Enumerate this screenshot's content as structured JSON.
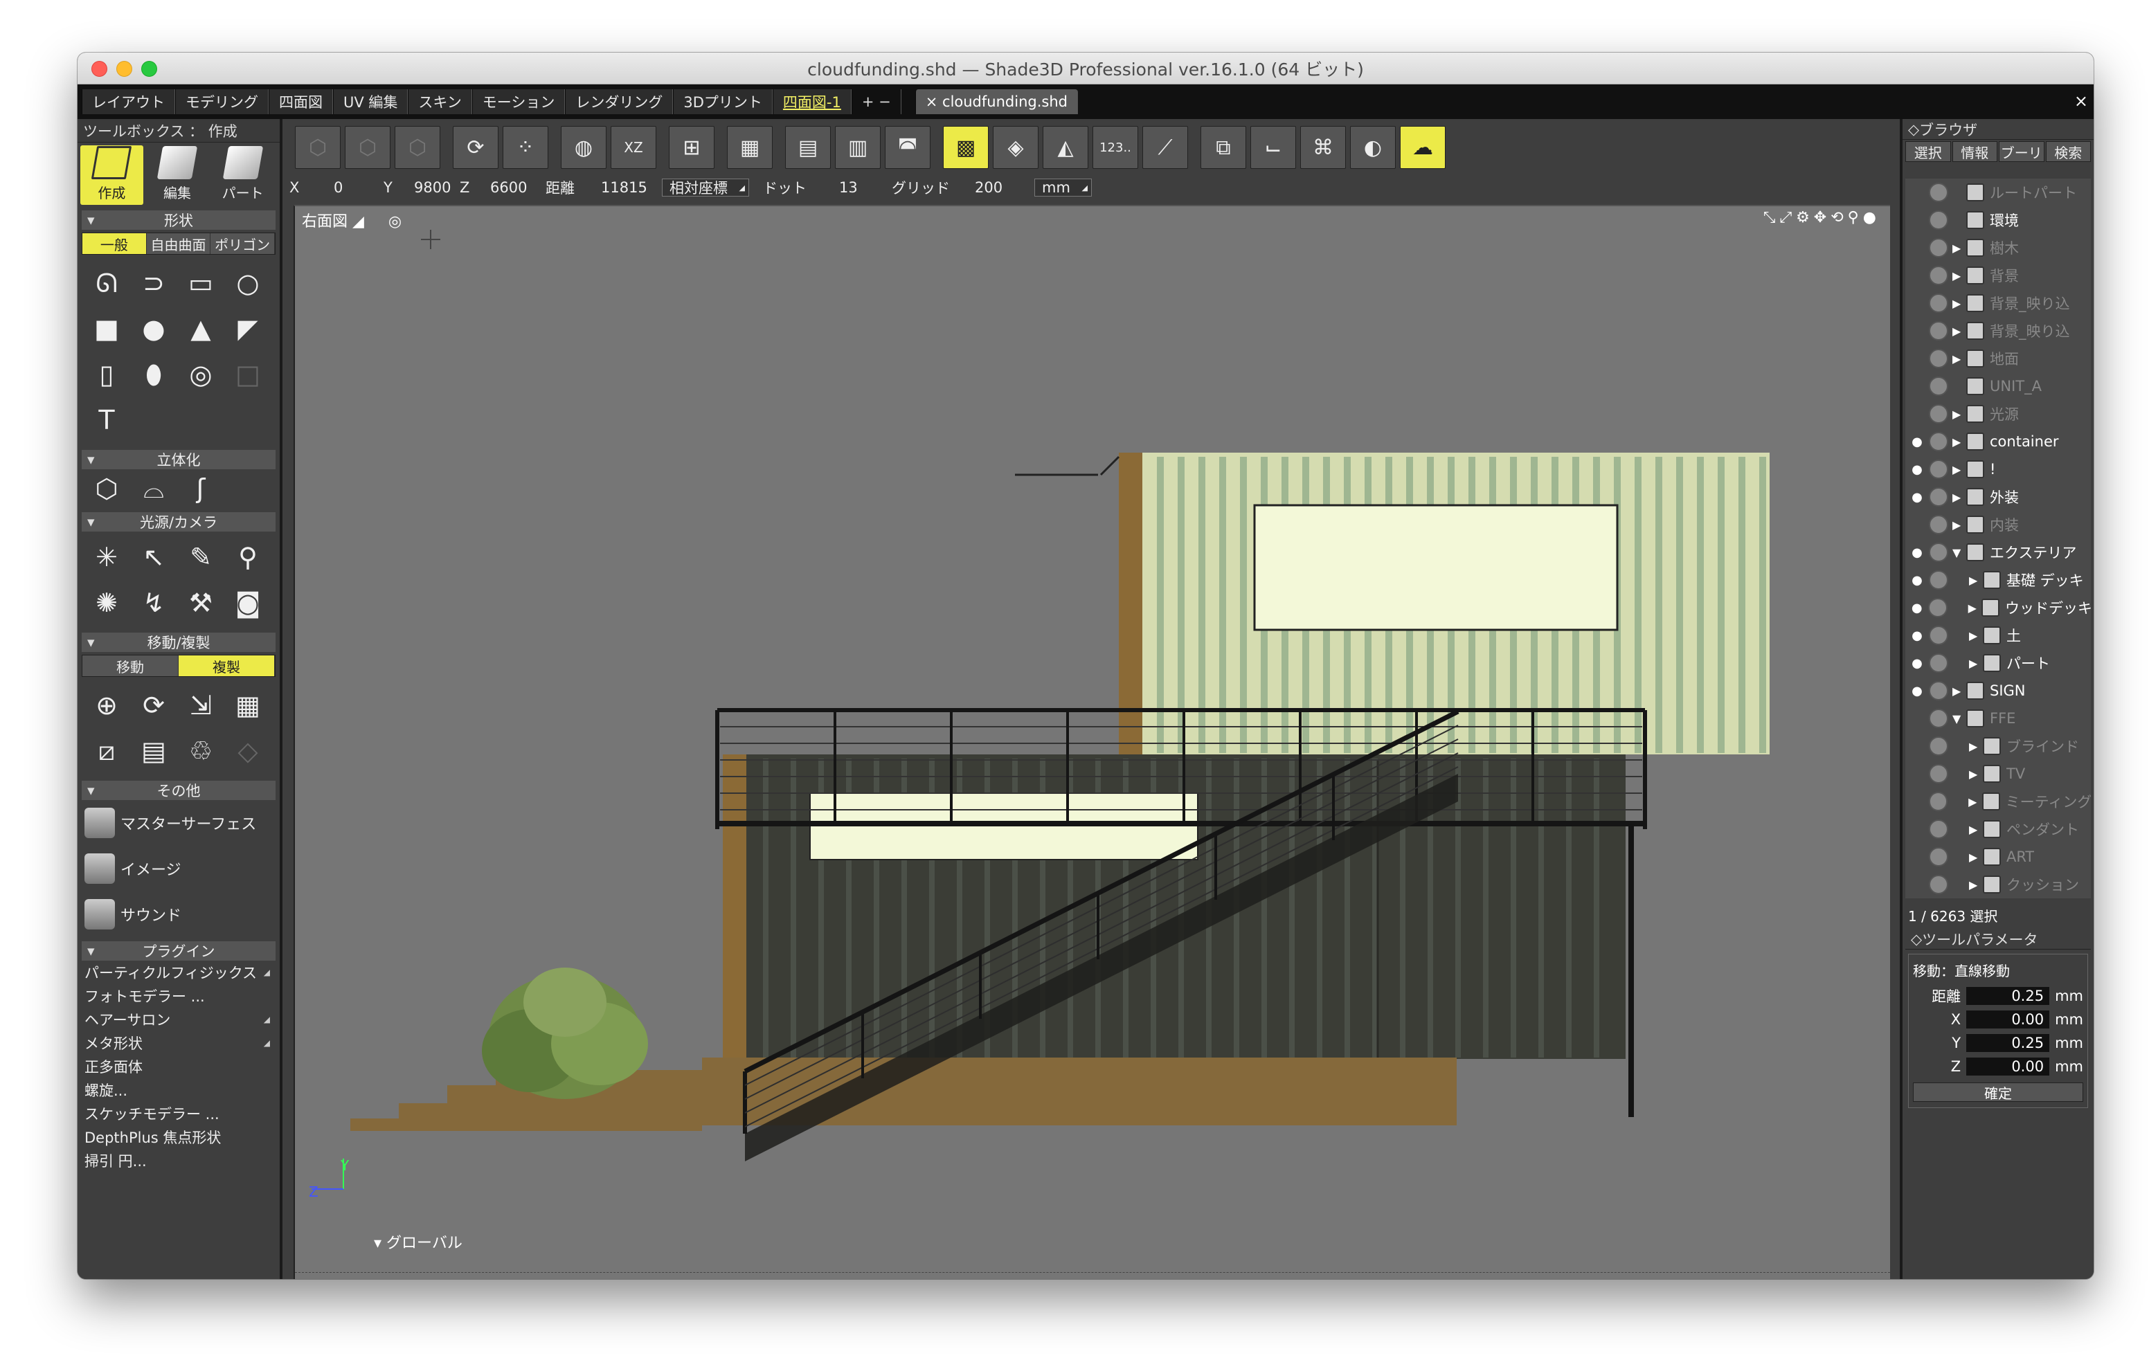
{
  "window": {
    "title": "cloudfunding.shd — Shade3D Professional ver.16.1.0 (64 ビット)"
  },
  "tabs": [
    "レイアウト",
    "モデリング",
    "四面図",
    "UV 編集",
    "スキン",
    "モーション",
    "レンダリング",
    "3Dプリント"
  ],
  "active_tab": "四面図-1",
  "tab_plus": "+ −",
  "doc_tab": "× cloudfunding.shd",
  "toolbox": {
    "title": "ツールボックス ： 作成",
    "modes": [
      "作成",
      "編集",
      "パート"
    ],
    "sections": {
      "shape": "形状",
      "solidify": "立体化",
      "light_camera": "光源/カメラ",
      "move_copy": "移動/複製",
      "other": "その他",
      "plugin": "プラグイン"
    },
    "shape_tabs": [
      "一般",
      "自由曲面",
      "ポリゴン"
    ],
    "move_tabs": [
      "移動",
      "複製"
    ],
    "other_items": [
      "マスターサーフェス",
      "イメージ",
      "サウンド"
    ],
    "plugins": [
      "パーティクルフィジックス",
      "フォトモデラー ...",
      "ヘアーサロン",
      "メタ形状",
      "正多面体",
      "螺旋...",
      "スケッチモデラー ...",
      "DepthPlus 焦点形状",
      "掃引 円..."
    ]
  },
  "coords": {
    "x_label": "X",
    "x": "0",
    "y_label": "Y",
    "y": "9800",
    "z_label": "Z",
    "z": "6600",
    "dist_label": "距離",
    "dist": "11815",
    "mode": "相対座標",
    "dot_label": "ドット",
    "dot": "13",
    "grid_label": "グリッド",
    "grid": "200",
    "unit": "mm"
  },
  "viewport": {
    "view": "右面図",
    "global": "グローバル",
    "axis_y": "Y",
    "axis_z": "Z"
  },
  "toolbar_labels": {
    "xz": "XZ",
    "num": "123.."
  },
  "browser": {
    "title": "ブラウザ",
    "tabs": [
      "選択",
      "情報",
      "ブーリ",
      "検索"
    ],
    "tree": [
      {
        "label": "ルートパート",
        "eye": "",
        "indent": 0,
        "toggle": "",
        "dim": true
      },
      {
        "label": "環境",
        "eye": "",
        "indent": 0,
        "toggle": "",
        "dim": false
      },
      {
        "label": "樹木",
        "eye": "",
        "indent": 0,
        "toggle": "▶",
        "dim": true
      },
      {
        "label": "背景",
        "eye": "",
        "indent": 0,
        "toggle": "▶",
        "dim": true
      },
      {
        "label": "背景_映り込",
        "eye": "",
        "indent": 0,
        "toggle": "▶",
        "dim": true
      },
      {
        "label": "背景_映り込",
        "eye": "",
        "indent": 0,
        "toggle": "▶",
        "dim": true
      },
      {
        "label": "地面",
        "eye": "",
        "indent": 0,
        "toggle": "▶",
        "dim": true
      },
      {
        "label": "UNIT_A",
        "eye": "",
        "indent": 0,
        "toggle": "",
        "dim": true
      },
      {
        "label": "光源",
        "eye": "",
        "indent": 0,
        "toggle": "▶",
        "dim": true
      },
      {
        "label": "container",
        "eye": "●",
        "indent": 0,
        "toggle": "▶",
        "dim": false
      },
      {
        "label": "!",
        "eye": "●",
        "indent": 0,
        "toggle": "▶",
        "dim": false
      },
      {
        "label": "外装",
        "eye": "●",
        "indent": 0,
        "toggle": "▶",
        "dim": false
      },
      {
        "label": "内装",
        "eye": "",
        "indent": 0,
        "toggle": "▶",
        "dim": true
      },
      {
        "label": "エクステリア",
        "eye": "●",
        "indent": 0,
        "toggle": "▼",
        "dim": false
      },
      {
        "label": "基礎 デッキ",
        "eye": "●",
        "indent": 1,
        "toggle": "▶",
        "dim": false
      },
      {
        "label": "ウッドデッキ",
        "eye": "●",
        "indent": 1,
        "toggle": "▶",
        "dim": false
      },
      {
        "label": "土",
        "eye": "●",
        "indent": 1,
        "toggle": "▶",
        "dim": false
      },
      {
        "label": "パート",
        "eye": "●",
        "indent": 1,
        "toggle": "▶",
        "dim": false
      },
      {
        "label": "SIGN",
        "eye": "●",
        "indent": 0,
        "toggle": "▶",
        "dim": false
      },
      {
        "label": "FFE",
        "eye": "",
        "indent": 0,
        "toggle": "▼",
        "dim": true
      },
      {
        "label": "ブラインド",
        "eye": "",
        "indent": 1,
        "toggle": "▶",
        "dim": true
      },
      {
        "label": "TV",
        "eye": "",
        "indent": 1,
        "toggle": "▶",
        "dim": true
      },
      {
        "label": "ミーティング",
        "eye": "",
        "indent": 1,
        "toggle": "▶",
        "dim": true
      },
      {
        "label": "ペンダント",
        "eye": "",
        "indent": 1,
        "toggle": "▶",
        "dim": true
      },
      {
        "label": "ART",
        "eye": "",
        "indent": 1,
        "toggle": "▶",
        "dim": true
      },
      {
        "label": "クッション",
        "eye": "",
        "indent": 1,
        "toggle": "▶",
        "dim": true
      }
    ],
    "selection": "1 / 6263 選択"
  },
  "toolparams": {
    "title": "ツールパラメータ",
    "group": "移動：直線移動",
    "rows": [
      {
        "label": "距離",
        "value": "0.25",
        "unit": "mm"
      },
      {
        "label": "X",
        "value": "0.00",
        "unit": "mm"
      },
      {
        "label": "Y",
        "value": "0.25",
        "unit": "mm"
      },
      {
        "label": "Z",
        "value": "0.00",
        "unit": "mm"
      }
    ],
    "confirm": "確定"
  }
}
